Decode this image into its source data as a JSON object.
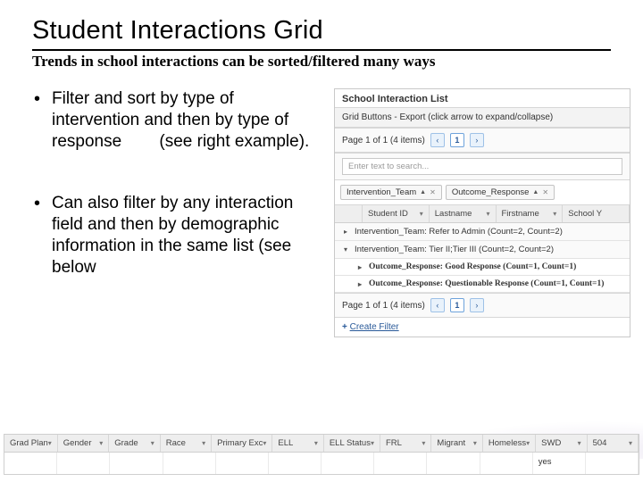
{
  "header": {
    "title": "Student Interactions Grid",
    "subtitle": "Trends in school interactions can be sorted/filtered many ways"
  },
  "bullets": [
    "Filter and sort by type of intervention and then by type of response        (see right example).",
    "Can also filter by any interaction field and then by demographic information in the same list (see below"
  ],
  "panel": {
    "title": "School Interaction List",
    "gridButtons": "Grid Buttons - Export (click arrow to expand/collapse)",
    "pager": "Page 1 of 1 (4 items)",
    "pageNum": "1",
    "searchPlaceholder": "Enter text to search...",
    "chips": [
      {
        "label": "Intervention_Team",
        "dir": "▲"
      },
      {
        "label": "Outcome_Response",
        "dir": "▲"
      }
    ],
    "columns": [
      "Student ID",
      "Lastname",
      "Firstname",
      "School Y"
    ],
    "groups": [
      {
        "expand": "▸",
        "text": "Intervention_Team: Refer to Admin (Count=2, Count=2)"
      },
      {
        "expand": "▾",
        "text": "Intervention_Team: Tier II;Tier III (Count=2, Count=2)"
      }
    ],
    "subgroups": [
      {
        "expand": "▸",
        "text": "Outcome_Response: Good Response (Count=1, Count=1)"
      },
      {
        "expand": "▸",
        "text": "Outcome_Response: Questionable Response (Count=1, Count=1)"
      }
    ],
    "pager2": "Page 1 of 1 (4 items)",
    "createFilter": "Create Filter"
  },
  "strip": {
    "columns": [
      "Grad Plan",
      "Gender",
      "Grade",
      "Race",
      "Primary Exc",
      "ELL",
      "ELL Status",
      "FRL",
      "Migrant",
      "Homeless",
      "SWD",
      "504"
    ],
    "values": [
      "",
      "",
      "",
      "",
      "",
      "",
      "",
      "",
      "",
      "",
      "yes",
      ""
    ]
  }
}
